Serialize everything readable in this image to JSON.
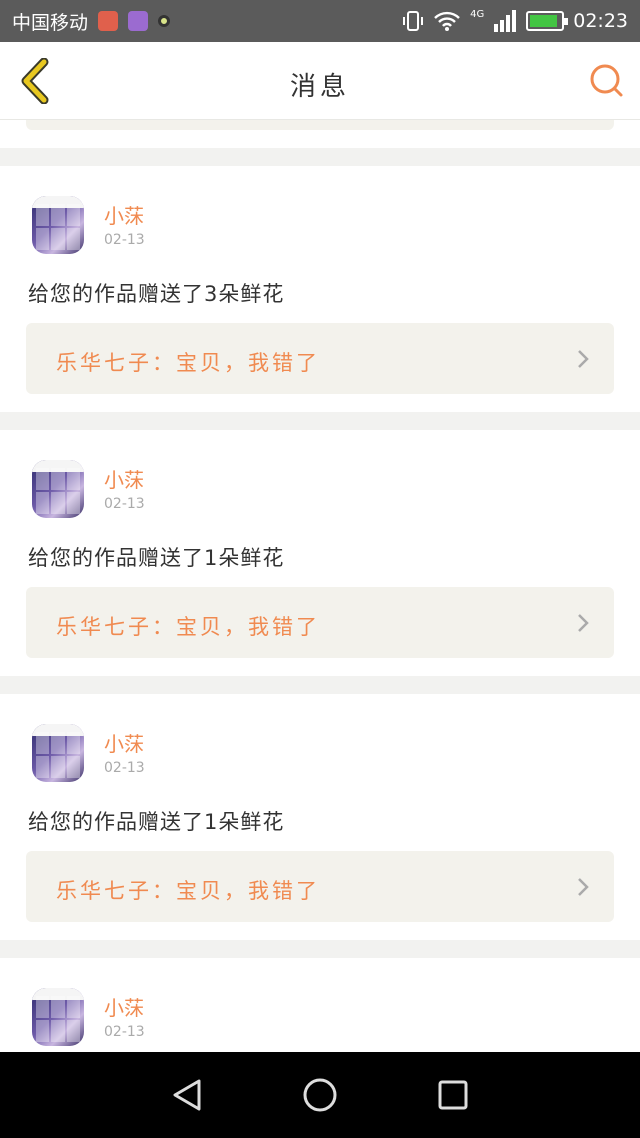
{
  "status_bar": {
    "carrier": "中国移动",
    "network": "4G",
    "time": "02:23",
    "battery_level": 0.9,
    "icons": [
      "mail-app-icon",
      "gallery-app-icon",
      "status-dot-icon",
      "vibrate-icon",
      "wifi-icon",
      "signal-icon",
      "battery-icon"
    ]
  },
  "header": {
    "title": "消息",
    "back_icon": "chevron-left-icon",
    "search_icon": "search-icon",
    "accent": "#f08a50",
    "back_color": "#e8c820"
  },
  "messages": [
    {
      "name": "小莯",
      "date": "02-13",
      "text": "给您的作品赠送了3朵鲜花",
      "quote": "乐华七子：宝贝，我错了"
    },
    {
      "name": "小莯",
      "date": "02-13",
      "text": "给您的作品赠送了1朵鲜花",
      "quote": "乐华七子：宝贝，我错了"
    },
    {
      "name": "小莯",
      "date": "02-13",
      "text": "给您的作品赠送了1朵鲜花",
      "quote": "乐华七子：宝贝，我错了"
    },
    {
      "name": "小莯",
      "date": "02-13"
    }
  ],
  "nav_bar": {
    "buttons": [
      "back-triangle-icon",
      "home-circle-icon",
      "recents-square-icon"
    ]
  }
}
